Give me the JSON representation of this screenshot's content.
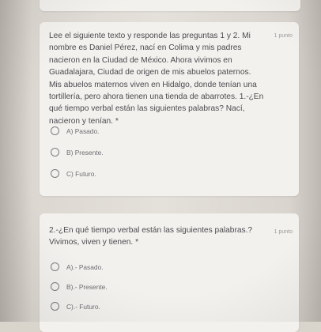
{
  "question1": {
    "text": "Lee el siguiente texto y responde las preguntas 1 y 2. Mi nombre es Daniel Pérez, nací en Colima y mis padres nacieron en la Ciudad de México. Ahora vivimos en Guadalajara, Ciudad de origen de mis abuelos paternos. Mis abuelos maternos viven en Hidalgo, donde tenían una tortillería, pero ahora tienen una tienda de abarrotes. 1.-¿En qué tiempo verbal están las siguientes palabras? Nací, nacieron y tenían. *",
    "points": "1 punto",
    "options": [
      "A) Pasado.",
      "B) Presente.",
      "C) Futuro."
    ]
  },
  "question2": {
    "text": "2.-¿En qué tiempo verbal están las siguientes palabras.? Vivimos, viven y tienen. *",
    "points": "1 punto",
    "options": [
      "A).- Pasado.",
      "B).- Presente.",
      "C).- Futuro."
    ]
  }
}
